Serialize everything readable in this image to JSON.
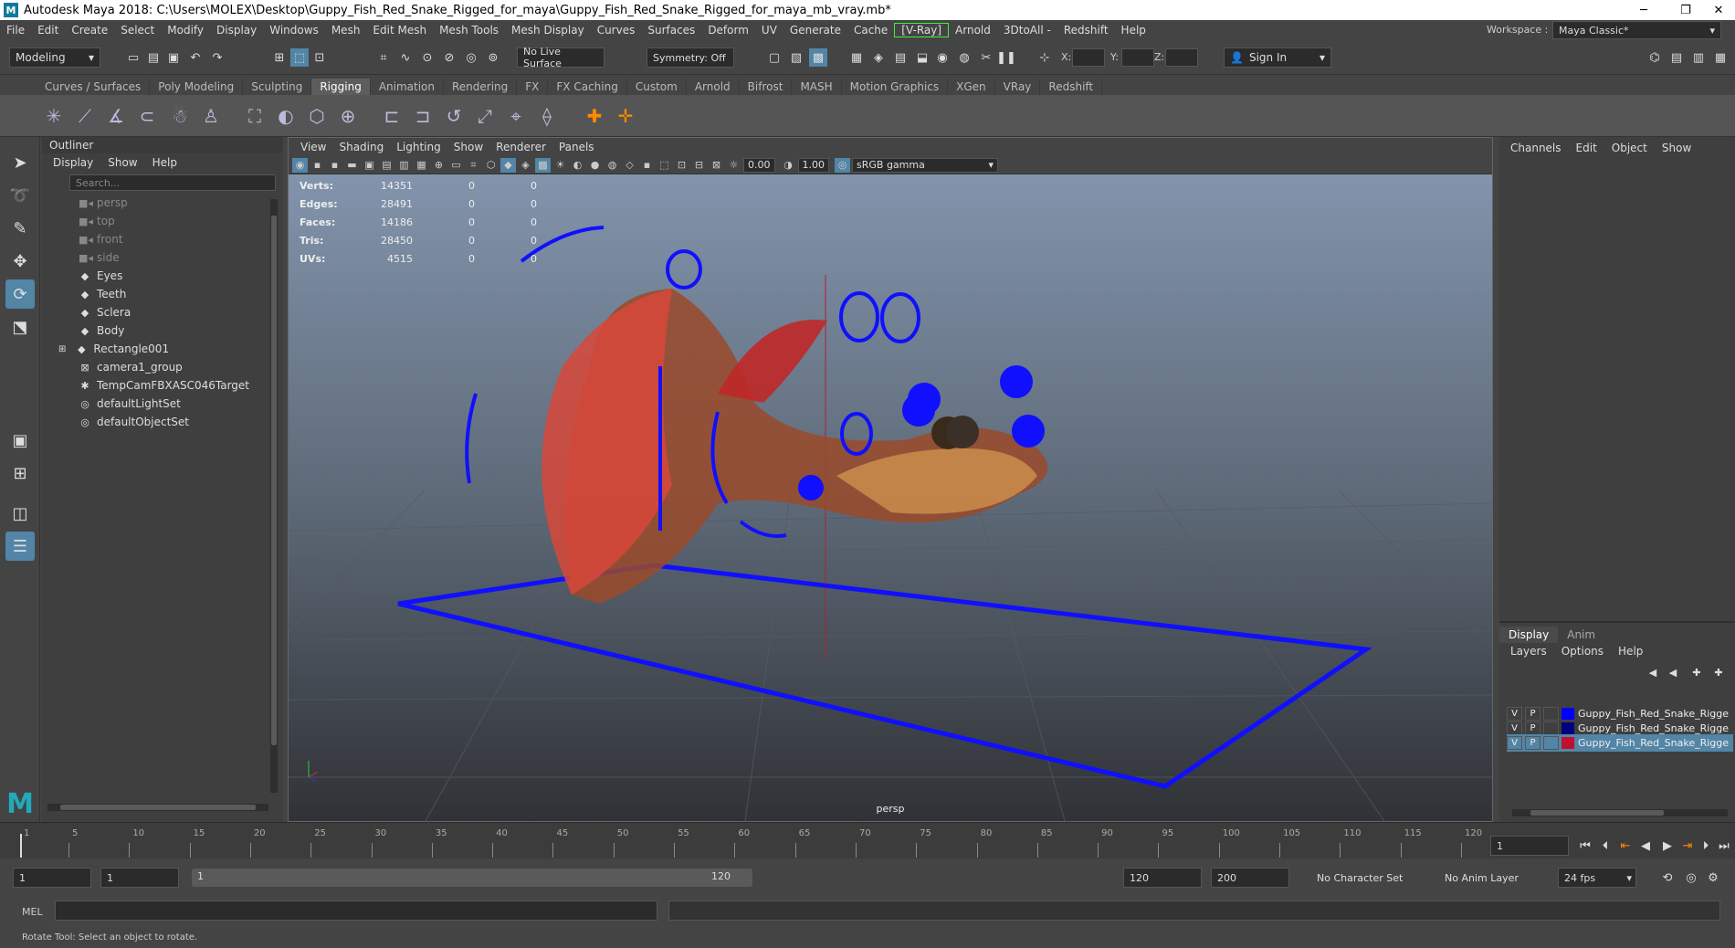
{
  "window": {
    "title": "Autodesk Maya 2018: C:\\Users\\MOLEX\\Desktop\\Guppy_Fish_Red_Snake_Rigged_for_maya\\Guppy_Fish_Red_Snake_Rigged_for_maya_mb_vray.mb*",
    "logo": "M",
    "minimize": "─",
    "restore": "❐",
    "close": "✕"
  },
  "menubar": {
    "items": [
      "File",
      "Edit",
      "Create",
      "Select",
      "Modify",
      "Display",
      "Windows",
      "Mesh",
      "Edit Mesh",
      "Mesh Tools",
      "Mesh Display",
      "Curves",
      "Surfaces",
      "Deform",
      "UV",
      "Generate",
      "Cache",
      "[V-Ray]",
      "Arnold",
      "3DtoAll -",
      "Redshift",
      "Help"
    ],
    "workspace_label": "Workspace :",
    "workspace_value": "Maya Classic*"
  },
  "statusline": {
    "mode": "Modeling",
    "live_surface": "No Live Surface",
    "symmetry": "Symmetry: Off",
    "x_label": "X:",
    "y_label": "Y:",
    "z_label": "Z:",
    "sign_in": "Sign In"
  },
  "shelf_tabs": [
    "Curves / Surfaces",
    "Poly Modeling",
    "Sculpting",
    "Rigging",
    "Animation",
    "Rendering",
    "FX",
    "FX Caching",
    "Custom",
    "Arnold",
    "Bifrost",
    "MASH",
    "Motion Graphics",
    "XGen",
    "VRay",
    "Redshift"
  ],
  "active_shelf_tab": "Rigging",
  "outliner": {
    "title": "Outliner",
    "menu": [
      "Display",
      "Show",
      "Help"
    ],
    "search_placeholder": "Search...",
    "items": [
      {
        "label": "persp",
        "icon": "camera-icon",
        "dim": true
      },
      {
        "label": "top",
        "icon": "camera-icon",
        "dim": true
      },
      {
        "label": "front",
        "icon": "camera-icon",
        "dim": true
      },
      {
        "label": "side",
        "icon": "camera-icon",
        "dim": true
      },
      {
        "label": "Eyes",
        "icon": "mesh-icon",
        "dim": false
      },
      {
        "label": "Teeth",
        "icon": "mesh-icon",
        "dim": false
      },
      {
        "label": "Sclera",
        "icon": "mesh-icon",
        "dim": false
      },
      {
        "label": "Body",
        "icon": "mesh-icon",
        "dim": false
      },
      {
        "label": "Rectangle001",
        "icon": "mesh-icon",
        "dim": false,
        "expandable": true
      },
      {
        "label": "camera1_group",
        "icon": "group-icon",
        "dim": false
      },
      {
        "label": "TempCamFBXASC046Target",
        "icon": "locator-icon",
        "dim": false
      },
      {
        "label": "defaultLightSet",
        "icon": "set-icon",
        "dim": false
      },
      {
        "label": "defaultObjectSet",
        "icon": "set-icon",
        "dim": false
      }
    ]
  },
  "viewport": {
    "menu": [
      "View",
      "Shading",
      "Lighting",
      "Show",
      "Renderer",
      "Panels"
    ],
    "exposure": "0.00",
    "gamma": "1.00",
    "color_space": "sRGB gamma",
    "camera_label": "persp",
    "hud": [
      {
        "label": "Verts:",
        "v1": "14351",
        "v2": "0",
        "v3": "0"
      },
      {
        "label": "Edges:",
        "v1": "28491",
        "v2": "0",
        "v3": "0"
      },
      {
        "label": "Faces:",
        "v1": "14186",
        "v2": "0",
        "v3": "0"
      },
      {
        "label": "Tris:",
        "v1": "28450",
        "v2": "0",
        "v3": "0"
      },
      {
        "label": "UVs:",
        "v1": "4515",
        "v2": "0",
        "v3": "0"
      }
    ]
  },
  "channel_box": {
    "menu": [
      "Channels",
      "Edit",
      "Object",
      "Show"
    ]
  },
  "layer_editor": {
    "tabs": [
      "Display",
      "Anim"
    ],
    "menu": [
      "Layers",
      "Options",
      "Help"
    ],
    "layers": [
      {
        "v": "V",
        "p": "P",
        "name": "Guppy_Fish_Red_Snake_Rigge",
        "color": "#0000ff",
        "selected": false
      },
      {
        "v": "V",
        "p": "P",
        "name": "Guppy_Fish_Red_Snake_Rigge",
        "color": "#000080",
        "selected": false
      },
      {
        "v": "V",
        "p": "P",
        "name": "Guppy_Fish_Red_Snake_Rigge",
        "color": "#c01030",
        "selected": true
      }
    ]
  },
  "time_slider": {
    "ticks": [
      "1",
      "5",
      "10",
      "15",
      "20",
      "25",
      "30",
      "35",
      "40",
      "45",
      "50",
      "55",
      "60",
      "65",
      "70",
      "75",
      "80",
      "85",
      "90",
      "95",
      "100",
      "105",
      "110",
      "115",
      "120"
    ],
    "current_frame": "1"
  },
  "range_slider": {
    "start": "1",
    "playback_start": "1",
    "range_start_label": "1",
    "range_end_label": "120",
    "playback_end": "120",
    "end": "200",
    "character_set": "No Character Set",
    "anim_layer": "No Anim Layer",
    "fps": "24 fps"
  },
  "command_line": {
    "label": "MEL"
  },
  "help_line": "Rotate Tool: Select an object to rotate."
}
